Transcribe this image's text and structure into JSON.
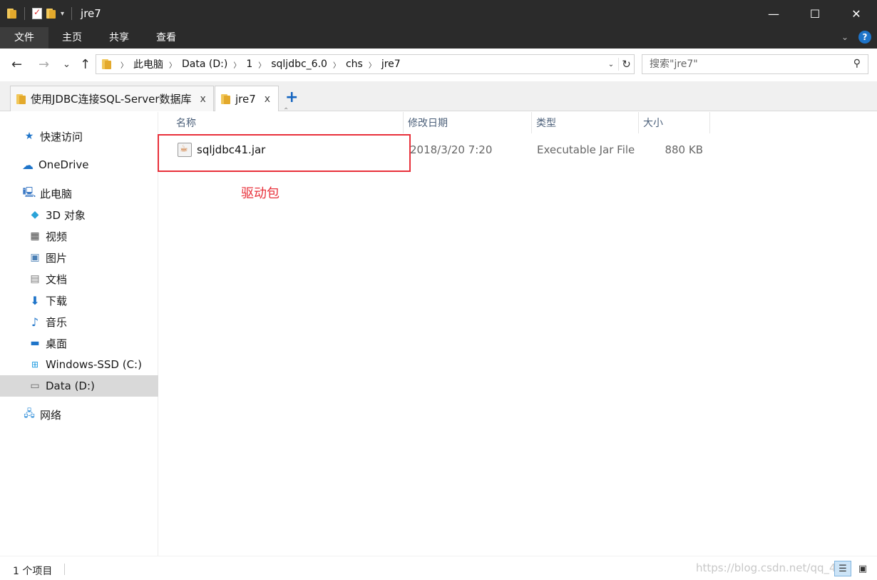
{
  "window": {
    "title": "jre7",
    "controls": {
      "minimize": "—",
      "maximize": "☐",
      "close": "✕"
    }
  },
  "ribbon": {
    "tabs": [
      "文件",
      "主页",
      "共享",
      "查看"
    ],
    "help": "?"
  },
  "navigation": {
    "back": "←",
    "forward": "→",
    "recent": "⌄",
    "up": "↑"
  },
  "address": {
    "crumbs": [
      "此电脑",
      "Data (D:)",
      "1",
      "sqljdbc_6.0",
      "chs",
      "jre7"
    ]
  },
  "search": {
    "placeholder": "搜索\"jre7\""
  },
  "folder_tabs": [
    {
      "label": "使用JDBC连接SQL-Server数据库",
      "close": "x"
    },
    {
      "label": "jre7",
      "close": "x"
    }
  ],
  "add_tab": "+",
  "sidebar": {
    "items": [
      {
        "label": "快速访问",
        "icon": "star-icon"
      },
      {
        "label": "OneDrive",
        "icon": "cloud-icon"
      },
      {
        "label": "此电脑",
        "icon": "computer-icon"
      },
      {
        "label": "3D 对象",
        "icon": "cube-icon"
      },
      {
        "label": "视频",
        "icon": "film-icon"
      },
      {
        "label": "图片",
        "icon": "picture-icon"
      },
      {
        "label": "文档",
        "icon": "document-icon"
      },
      {
        "label": "下载",
        "icon": "download-icon"
      },
      {
        "label": "音乐",
        "icon": "music-icon"
      },
      {
        "label": "桌面",
        "icon": "desktop-icon"
      },
      {
        "label": "Windows-SSD (C:)",
        "icon": "windows-drive-icon"
      },
      {
        "label": "Data (D:)",
        "icon": "drive-icon",
        "selected": true
      },
      {
        "label": "网络",
        "icon": "network-icon"
      }
    ]
  },
  "file_list": {
    "columns": [
      "名称",
      "修改日期",
      "类型",
      "大小"
    ],
    "rows": [
      {
        "name": "sqljdbc41.jar",
        "date": "2018/3/20 7:20",
        "type": "Executable Jar File",
        "size": "880 KB"
      }
    ]
  },
  "annotation": {
    "text": "驱动包",
    "color": "#e8303a"
  },
  "status": {
    "count": "1 个项目",
    "watermark": "https://blog.csdn.net/qq_45"
  },
  "colors": {
    "titlebar": "#2b2b2b",
    "accent": "#1565c0",
    "selection": "#d9d9d9",
    "header_text": "#4c607a"
  }
}
